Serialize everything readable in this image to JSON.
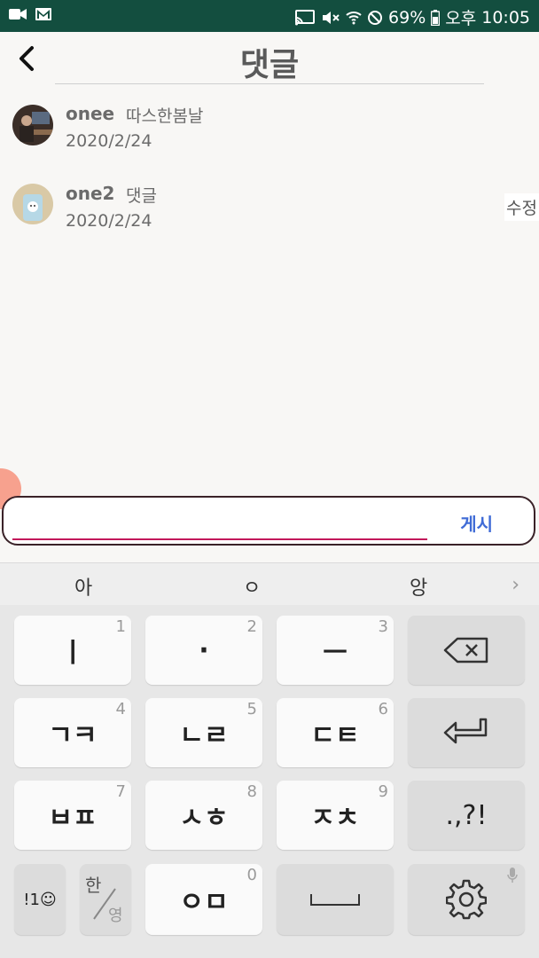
{
  "status_bar": {
    "battery": "69%",
    "time_period": "오후",
    "time": "10:05"
  },
  "header": {
    "title": "댓글"
  },
  "comments": [
    {
      "name": "onee",
      "text": "따스한봄날",
      "date": "2020/2/24"
    },
    {
      "name": "one2",
      "text": "댓글",
      "date": "2020/2/24",
      "edit_label": "수정"
    }
  ],
  "input": {
    "value": "",
    "placeholder": "",
    "post_label": "게시"
  },
  "keyboard": {
    "suggestions": [
      "아",
      "ㅇ",
      "앙"
    ],
    "keys": [
      {
        "label": "ㅣ",
        "num": "1"
      },
      {
        "label": "·",
        "num": "2"
      },
      {
        "label": "ㅡ",
        "num": "3"
      },
      {
        "label": "ㄱㅋ",
        "num": "4"
      },
      {
        "label": "ㄴㄹ",
        "num": "5"
      },
      {
        "label": "ㄷㅌ",
        "num": "6"
      },
      {
        "label": "ㅂㅍ",
        "num": "7"
      },
      {
        "label": "ㅅㅎ",
        "num": "8"
      },
      {
        "label": "ㅈㅊ",
        "num": "9"
      },
      {
        "label": "ㅇㅁ",
        "num": "0"
      }
    ],
    "punct_label": ".,?!",
    "symbol_label": "!1☺",
    "lang_top": "한",
    "lang_bottom": "영"
  },
  "colors": {
    "status_bar": "#134e3f",
    "accent_underline": "#c2185b",
    "post_button": "#3f6bd6",
    "fab": "#f7a18e"
  }
}
